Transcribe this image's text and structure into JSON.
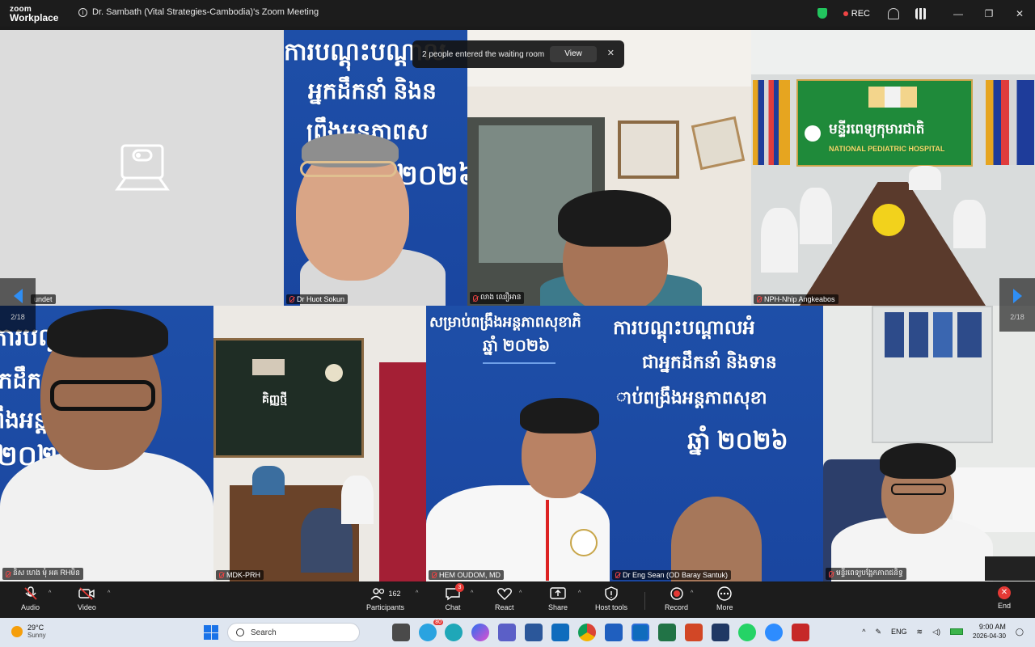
{
  "titlebar": {
    "logo_line1": "zoom",
    "logo_line2": "Workplace",
    "meeting_title": "Dr. Sambath (Vital Strategies-Cambodia)'s Zoom Meeting",
    "rec_label": "REC"
  },
  "waiting_room": {
    "message": "2 people entered the waiting room",
    "view_label": "View",
    "close": "✕"
  },
  "pager": {
    "left": "2/18",
    "right": "2/18"
  },
  "tiles": [
    {
      "name": "undet"
    },
    {
      "name": "Dr Huot Sokun"
    },
    {
      "name": "លាង ឈឿអាន"
    },
    {
      "name": "NPH-Nhip Angkeabos"
    },
    {
      "name": "និស ហេង មុំ អគ RHមិន"
    },
    {
      "name": "MDK-PRH"
    },
    {
      "name": "HEM OUDOM, MD"
    },
    {
      "name": "Dr Eng Sean (OD Baray Santuk)"
    },
    {
      "name": "មន្ទីរពេទ្យបង្អែកភាពជនិទ្ធ"
    }
  ],
  "banner_text": {
    "line_a": "ការបណ្តុះបណ្តាល",
    "line_b": "អ្នកដឹកនាំ និងន",
    "line_c": "ព្រឹងអន្តភាពស",
    "year": "២០២៦",
    "hospital_kh": "មន្ទីរពេទ្យកុមារជាតិ",
    "hospital_en": "NATIONAL PEDIATRIC HOSPITAL",
    "tile7_line1": "សម្រាប់ពង្រឹងអន្តភាពសុខាភិ",
    "tile7_year": "ឆ្នាំ ២០២៦",
    "tile8_line1": "ការបណ្តុះបណ្តាលអំ",
    "tile8_line2": "ជាអ្នកដឹកនាំ និងទាន",
    "tile8_line3": "ាប់ពង្រឹងអន្តភាពសុខា",
    "tile8_year": "ឆ្នាំ ២០២៦",
    "room_sign": "គិញ្ញថ្មី"
  },
  "toolbar": {
    "audio": "Audio",
    "video": "Video",
    "participants": "Participants",
    "participants_count": "162",
    "chat": "Chat",
    "chat_badge": "3",
    "react": "React",
    "share": "Share",
    "host_tools": "Host tools",
    "record": "Record",
    "more": "More",
    "end": "End"
  },
  "taskbar": {
    "temp": "29°C",
    "weather": "Sunny",
    "search_placeholder": "Search",
    "lang": "ENG",
    "time": "9:00 AM",
    "date": "2026-04-30",
    "mail_badge": "80"
  }
}
